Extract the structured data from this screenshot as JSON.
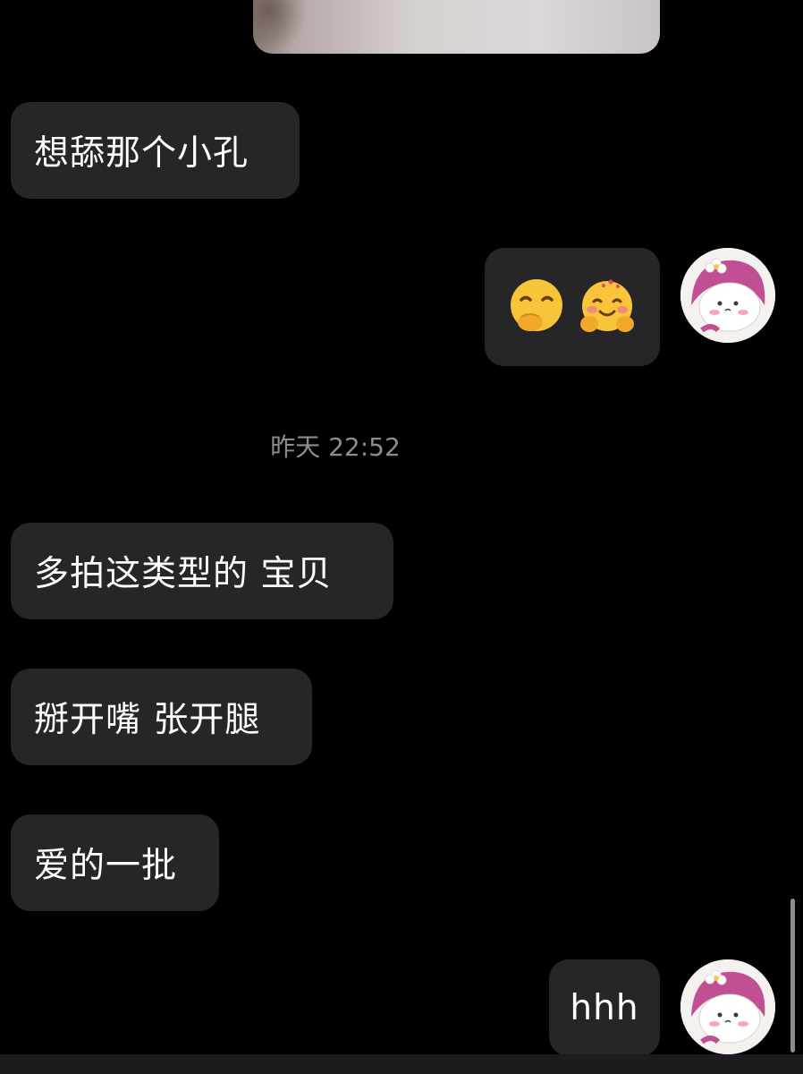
{
  "app": {
    "theme": "dark",
    "colors": {
      "background": "#000000",
      "bubble": "#262628",
      "text": "#ffffff",
      "timestamp": "#8d8d91",
      "avatar_accent": "#c14f93"
    }
  },
  "chat": {
    "messages": [
      {
        "side": "left",
        "type": "text",
        "text": "想舔那个小孔"
      },
      {
        "side": "right",
        "type": "emoji",
        "emojis": [
          "hand-over-mouth-emoji",
          "blushing-hugging-emoji"
        ]
      },
      {
        "side": "left",
        "type": "text",
        "text": "多拍这类型的 宝贝"
      },
      {
        "side": "left",
        "type": "text",
        "text": "掰开嘴 张开腿"
      },
      {
        "side": "left",
        "type": "text",
        "text": "爱的一批"
      },
      {
        "side": "right",
        "type": "text",
        "text": "hhh"
      }
    ],
    "timestamp": "昨天 22:52",
    "top_image": {
      "type": "photo"
    },
    "avatar": {
      "icon": "pink-hood-character-avatar"
    }
  }
}
